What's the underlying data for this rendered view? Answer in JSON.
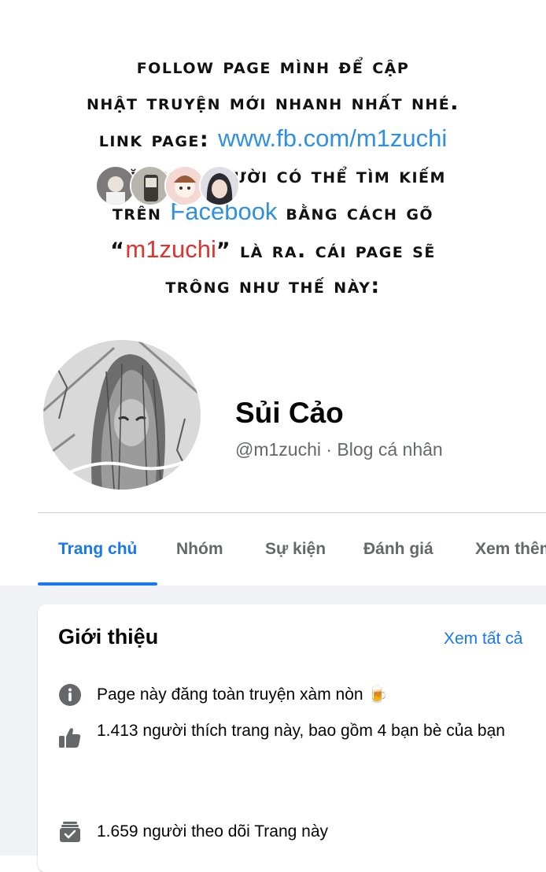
{
  "notice": {
    "line1": "FOLLOW PAGE MÌNH ĐỂ CẬP",
    "line2": "NHẬT TRUYỆN MỚI NHANH NHẤT NHÉ.",
    "line3_prefix": "LINK PAGE: ",
    "line3_link": "www.fb.com/m1zuchi",
    "line4": "HOẶC MỌI NGƯỜI CÓ THỂ TÌM KIẾM",
    "line5_prefix": "TRÊN ",
    "line5_link": "Facebook",
    "line5_suffix": " BẰNG CÁCH GÕ",
    "line6_open": "“",
    "line6_red": "m1zuchi",
    "line6_rest": "” LÀ RA. CÁI PAGE SẼ",
    "line7": "TRÔNG NHƯ THẾ NÀY:"
  },
  "profile": {
    "name": "Sủi Cảo",
    "subtitle": "@m1zuchi · Blog cá nhân"
  },
  "tabs": [
    {
      "label": "Trang chủ",
      "active": true
    },
    {
      "label": "Nhóm"
    },
    {
      "label": "Sự kiện"
    },
    {
      "label": "Đánh giá"
    },
    {
      "label": "Xem thêm"
    }
  ],
  "intro": {
    "title": "Giới thiệu",
    "see_all": "Xem tất cả",
    "items": [
      {
        "icon": "info-icon",
        "text": "Page này đăng toàn truyện xàm nòn 🍺"
      },
      {
        "icon": "like-icon",
        "text": "1.413 người thích trang này, bao gồm 4 bạn bè của bạn"
      },
      {
        "icon": "follow-icon",
        "text": "1.659 người theo dõi Trang này"
      }
    ]
  },
  "colors": {
    "link_blue": "#2f8fe0",
    "name_red": "#e2322e",
    "fb_blue": "#1877f2"
  }
}
